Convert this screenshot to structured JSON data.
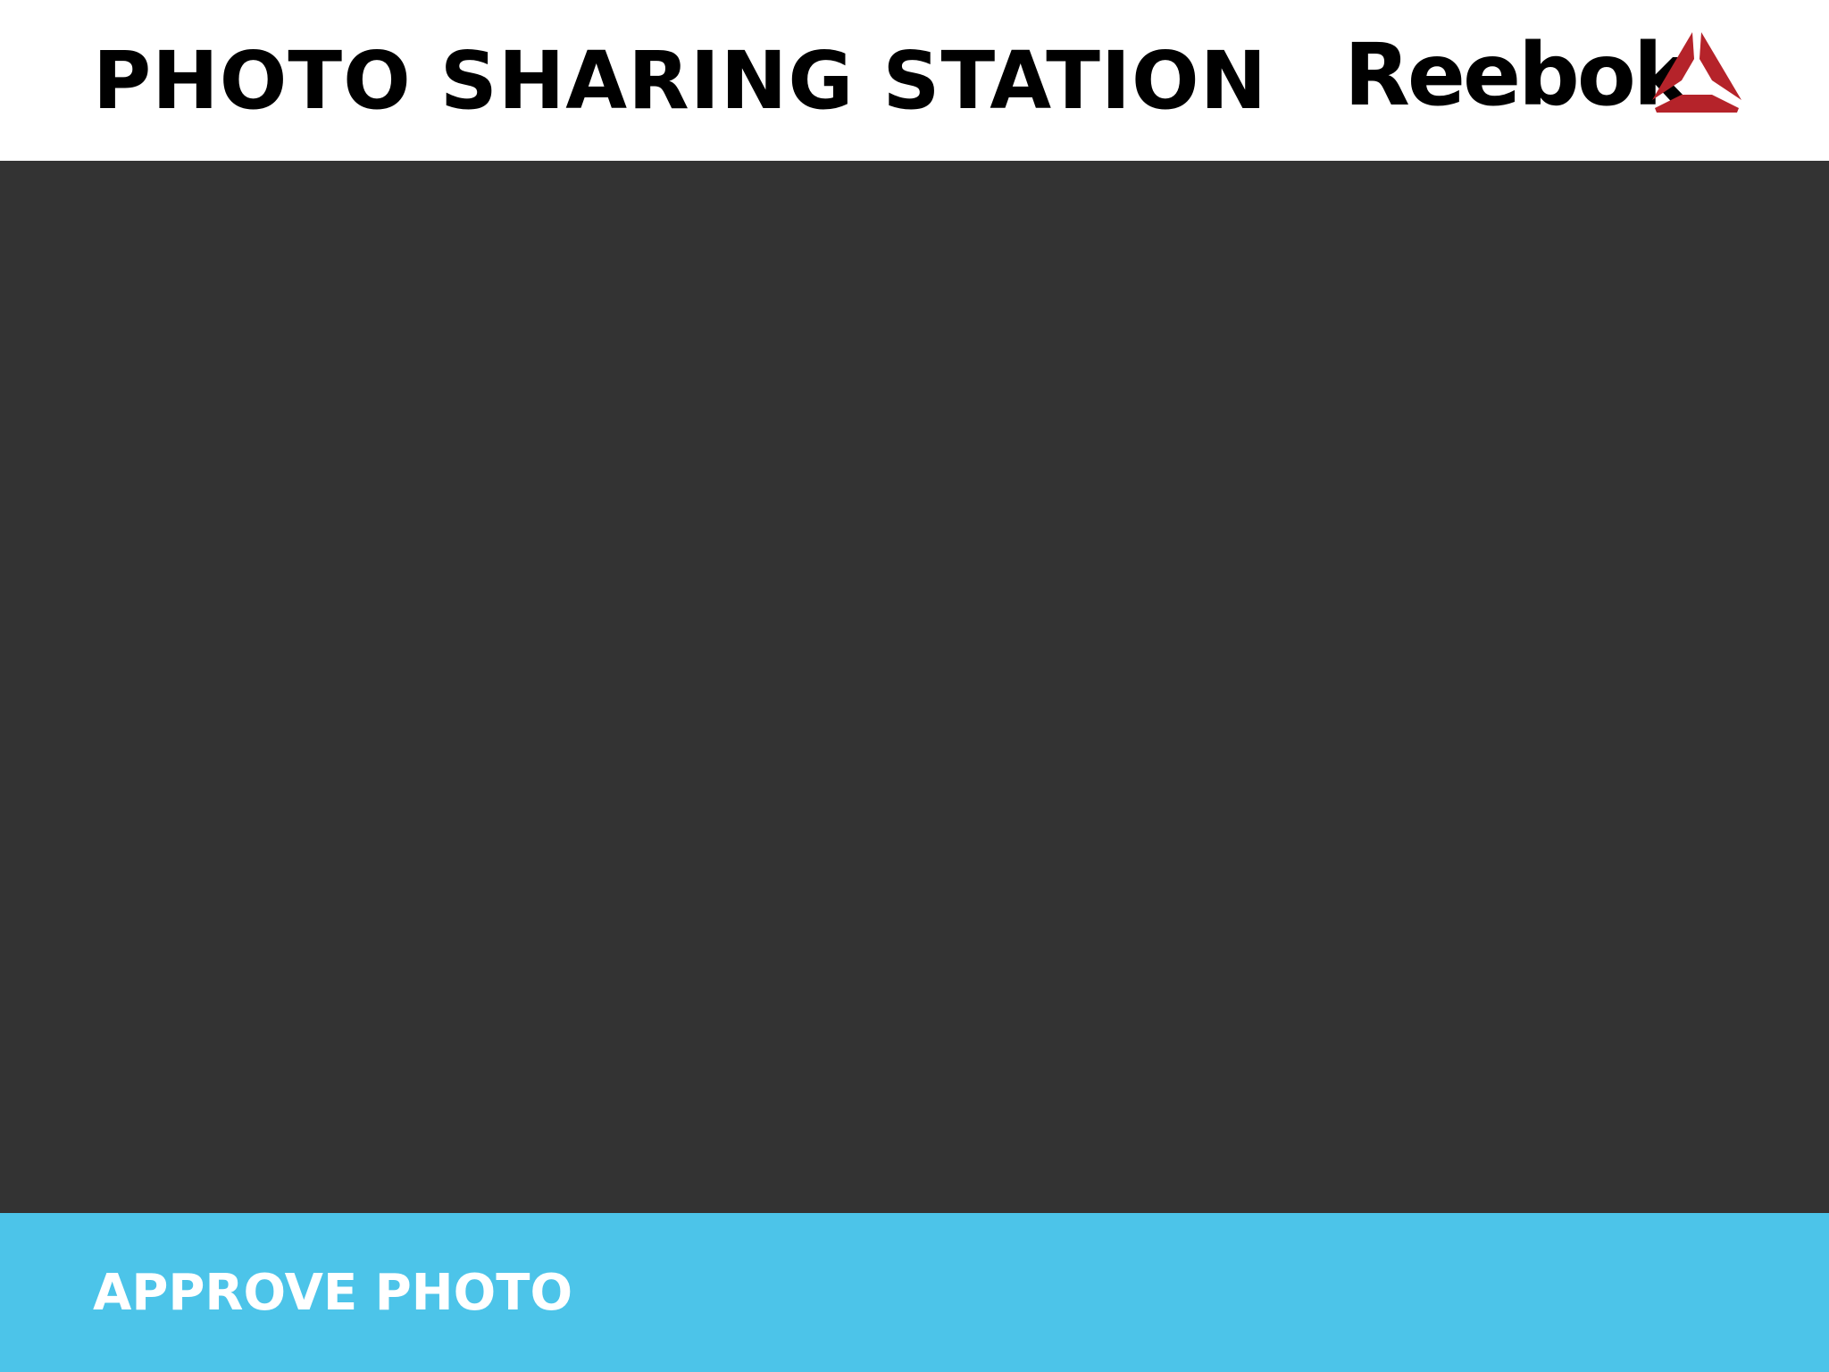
{
  "header": {
    "title": "PHOTO SHARING STATION",
    "brand": "Reebok",
    "brand_mark_icon": "delta-logo-icon",
    "brand_mark_color": "#b5232a"
  },
  "photo": {
    "background": "#333333"
  },
  "action": {
    "approve_label": "APPROVE PHOTO",
    "background": "#4cc4e9"
  }
}
